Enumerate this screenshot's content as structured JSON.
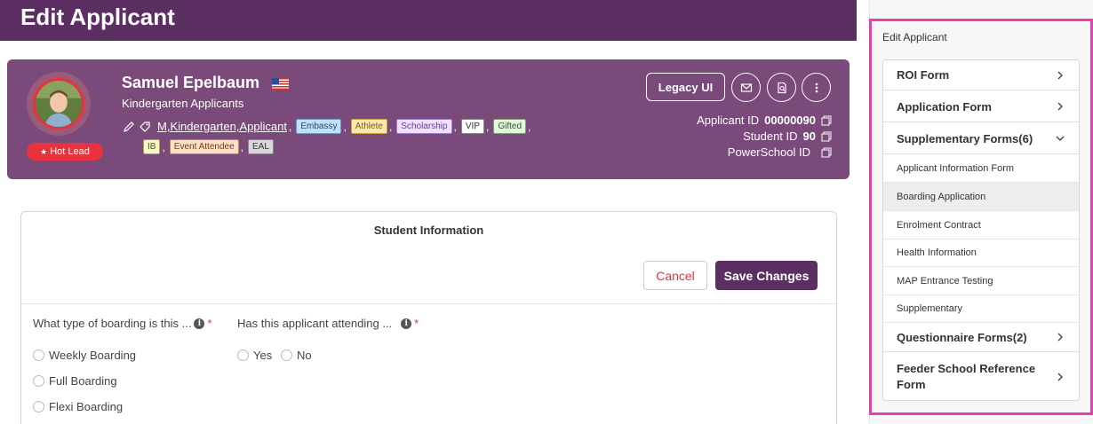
{
  "header": {
    "title": "Edit Applicant"
  },
  "profile": {
    "name": "Samuel Epelbaum",
    "subtitle": "Kindergarten Applicants",
    "hot_lead": "Hot Lead",
    "tag_link": "M,Kindergarten,Applicant",
    "chips_row1": [
      "Embassy",
      "Athlete",
      "Scholarship",
      "VIP",
      "Gifted"
    ],
    "chips_row2": [
      "IB",
      "Event Attendee",
      "EAL"
    ],
    "legacy_button": "Legacy UI",
    "ids": {
      "applicant_label": "Applicant ID",
      "applicant_value": "00000090",
      "student_label": "Student ID",
      "student_value": "90",
      "powerschool_label": "PowerSchool ID",
      "powerschool_value": ""
    }
  },
  "form": {
    "title": "Student Information",
    "cancel_label": "Cancel",
    "save_label": "Save Changes",
    "q1": {
      "label": "What type of boarding is this ...",
      "options": [
        "Weekly Boarding",
        "Full Boarding",
        "Flexi Boarding"
      ]
    },
    "q2": {
      "label": "Has this applicant attending ...",
      "options": [
        "Yes",
        "No"
      ]
    }
  },
  "sidebar": {
    "title": "Edit Applicant",
    "items": [
      {
        "label": "ROI Form"
      },
      {
        "label": "Application Form"
      },
      {
        "label": "Supplementary Forms(6)"
      },
      {
        "label": "Questionnaire Forms(2)"
      },
      {
        "label": "Feeder School Reference Form"
      }
    ],
    "sub_items": [
      {
        "label": "Applicant Information Form"
      },
      {
        "label": "Boarding Application"
      },
      {
        "label": "Enrolment Contract"
      },
      {
        "label": "Health Information"
      },
      {
        "label": "MAP Entrance Testing"
      },
      {
        "label": "Supplementary"
      }
    ]
  }
}
